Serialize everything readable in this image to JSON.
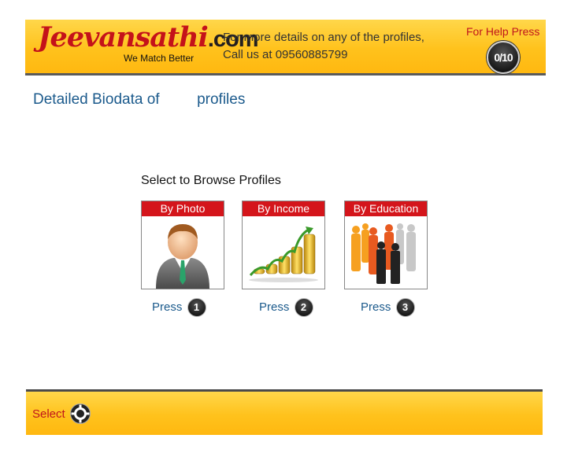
{
  "header": {
    "logo_part1": "Jeevansathi",
    "logo_part2": ".com",
    "tagline": "We Match Better",
    "info_line1": "For more details on any of the profiles,",
    "info_line2": "Call us at 09560885799",
    "help_label": "For Help Press",
    "help_counter": "0/10"
  },
  "main": {
    "title_part1": "Detailed Biodata of",
    "title_part2": "profiles",
    "browse_label": "Select to Browse Profiles",
    "options": [
      {
        "label": "By Photo",
        "press_label": "Press",
        "key": "1",
        "icon": "person-icon"
      },
      {
        "label": "By Income",
        "press_label": "Press",
        "key": "2",
        "icon": "income-growth-icon"
      },
      {
        "label": "By Education",
        "press_label": "Press",
        "key": "3",
        "icon": "education-people-icon"
      }
    ]
  },
  "footer": {
    "select_label": "Select",
    "select_icon": "remote-dpad-icon"
  },
  "colors": {
    "accent_yellow": "#ffc21c",
    "brand_red": "#c4121a",
    "text_blue": "#1b5a8c"
  }
}
